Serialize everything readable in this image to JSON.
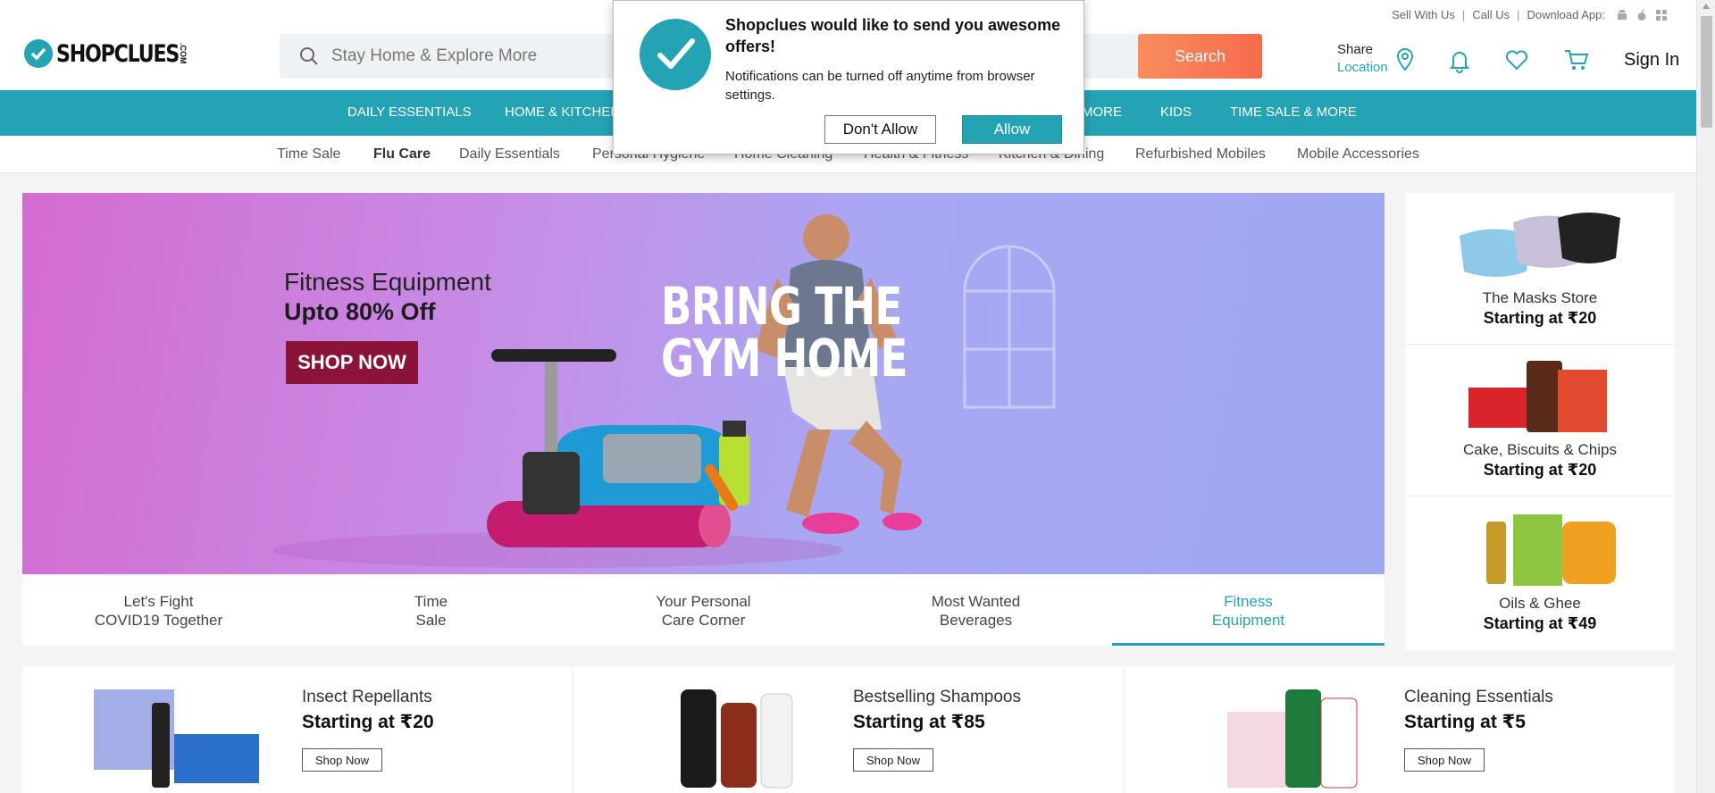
{
  "header": {
    "logo_text": "SHOPCLUES",
    "logo_suffix": ".COM",
    "top_links": [
      "Sell With Us",
      "Call Us",
      "Download App:"
    ],
    "search_placeholder": "Stay Home & Explore More",
    "search_button": "Search",
    "share_label": "Share",
    "location_label": "Location",
    "signin": "Sign In"
  },
  "category_nav": [
    "DAILY ESSENTIALS",
    "HOME & KITCHEN",
    "MORE",
    "KIDS",
    "TIME SALE & MORE"
  ],
  "sub_nav": [
    "Time Sale",
    "Flu Care",
    "Daily Essentials",
    "Personal Hygiene",
    "Home Cleaning",
    "Health & Fitness",
    "Kitchen & Dining",
    "Refurbished Mobiles",
    "Mobile Accessories"
  ],
  "banner": {
    "title": "Fitness Equipment",
    "offer": "Upto 80% Off",
    "cta": "SHOP NOW",
    "headline_line1": "BRING THE",
    "headline_line2": "GYM HOME"
  },
  "banner_tabs": [
    {
      "line1": "Let's Fight",
      "line2": "COVID19 Together"
    },
    {
      "line1": "Time",
      "line2": "Sale"
    },
    {
      "line1": "Your Personal",
      "line2": "Care Corner"
    },
    {
      "line1": "Most Wanted",
      "line2": "Beverages"
    },
    {
      "line1": "Fitness",
      "line2": "Equipment"
    }
  ],
  "active_banner_tab": 4,
  "side_deals": [
    {
      "name": "The Masks Store",
      "price": "Starting at ₹20"
    },
    {
      "name": "Cake, Biscuits & Chips",
      "price": "Starting at ₹20"
    },
    {
      "name": "Oils & Ghee",
      "price": "Starting at ₹49"
    }
  ],
  "cards": [
    {
      "title": "Insect Repellants",
      "price": "Starting at ₹20",
      "button": "Shop Now"
    },
    {
      "title": "Bestselling Shampoos",
      "price": "Starting at ₹85",
      "button": "Shop Now"
    },
    {
      "title": "Cleaning Essentials",
      "price": "Starting at ₹5",
      "button": "Shop Now"
    }
  ],
  "notification": {
    "title": "Shopclues would like to send you awesome offers!",
    "body": "Notifications can be turned off anytime from browser settings.",
    "deny": "Don't Allow",
    "allow": "Allow"
  },
  "colors": {
    "brand": "#24a3b5",
    "search_button": "#f87a53",
    "shop_now": "#8b1239"
  }
}
